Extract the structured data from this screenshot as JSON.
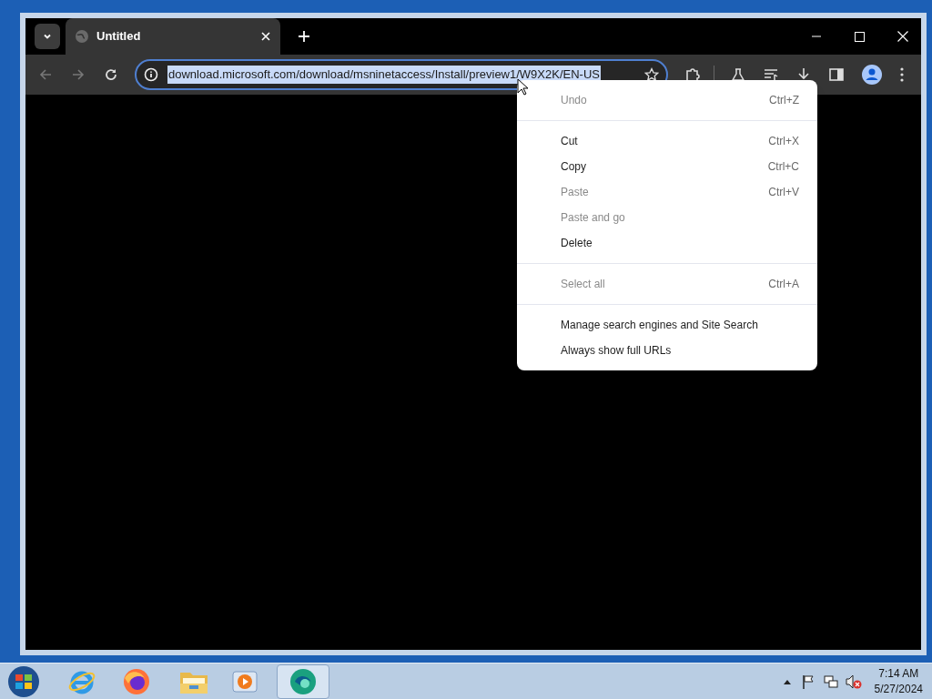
{
  "tab": {
    "title": "Untitled",
    "selected": true
  },
  "address_bar": {
    "url": "download.microsoft.com/download/msninetaccess/Install/preview1/W9X2K/EN-US",
    "selected": true
  },
  "context_menu": {
    "groups": [
      [
        {
          "label": "Undo",
          "shortcut": "Ctrl+Z",
          "disabled": true
        }
      ],
      [
        {
          "label": "Cut",
          "shortcut": "Ctrl+X",
          "disabled": false
        },
        {
          "label": "Copy",
          "shortcut": "Ctrl+C",
          "disabled": false
        },
        {
          "label": "Paste",
          "shortcut": "Ctrl+V",
          "disabled": true
        },
        {
          "label": "Paste and go",
          "disabled": true
        },
        {
          "label": "Delete",
          "disabled": false
        }
      ],
      [
        {
          "label": "Select all",
          "shortcut": "Ctrl+A",
          "disabled": true
        }
      ],
      [
        {
          "label": "Manage search engines and Site Search",
          "disabled": false
        },
        {
          "label": "Always show full URLs",
          "disabled": false
        }
      ]
    ]
  },
  "taskbar": {
    "time": "7:14 AM",
    "date": "5/27/2024"
  }
}
